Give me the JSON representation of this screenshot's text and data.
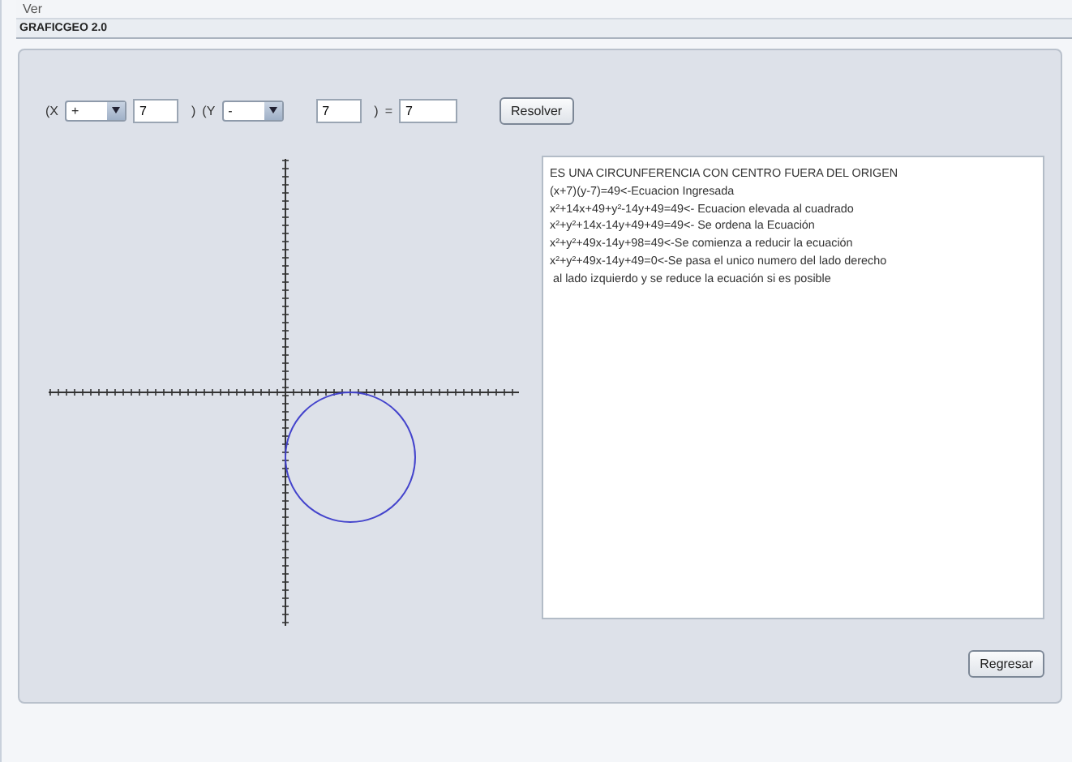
{
  "menu": [
    "Ver"
  ],
  "window": {
    "title": "GRAFICGEO 2.0"
  },
  "equation": {
    "open_x": "(X",
    "x_sign": "+",
    "x_value": "7",
    "close_x": ")",
    "open_y": "(Y",
    "y_sign": "-",
    "y_value": "7",
    "close_y": ")",
    "equals": "=",
    "r_value": "7"
  },
  "buttons": {
    "solve": "Resolver",
    "back": "Regresar"
  },
  "result_lines": [
    "ES UNA CIRCUNFERENCIA CON CENTRO FUERA DEL ORIGEN",
    "(x+7)(y-7)=49<-Ecuacion Ingresada",
    "x²+14x+49+y²-14y+49=49<- Ecuacion elevada al cuadrado",
    "x²+y²+14x-14y+49+49=49<- Se ordena la Ecuación",
    "x²+y²+49x-14y+98=49<-Se comienza a reducir la ecuación",
    "x²+y²+49x-14y+49=0<-Se pasa el unico numero del lado derecho",
    " al lado izquierdo y se reduce la ecuación si es posible"
  ]
}
